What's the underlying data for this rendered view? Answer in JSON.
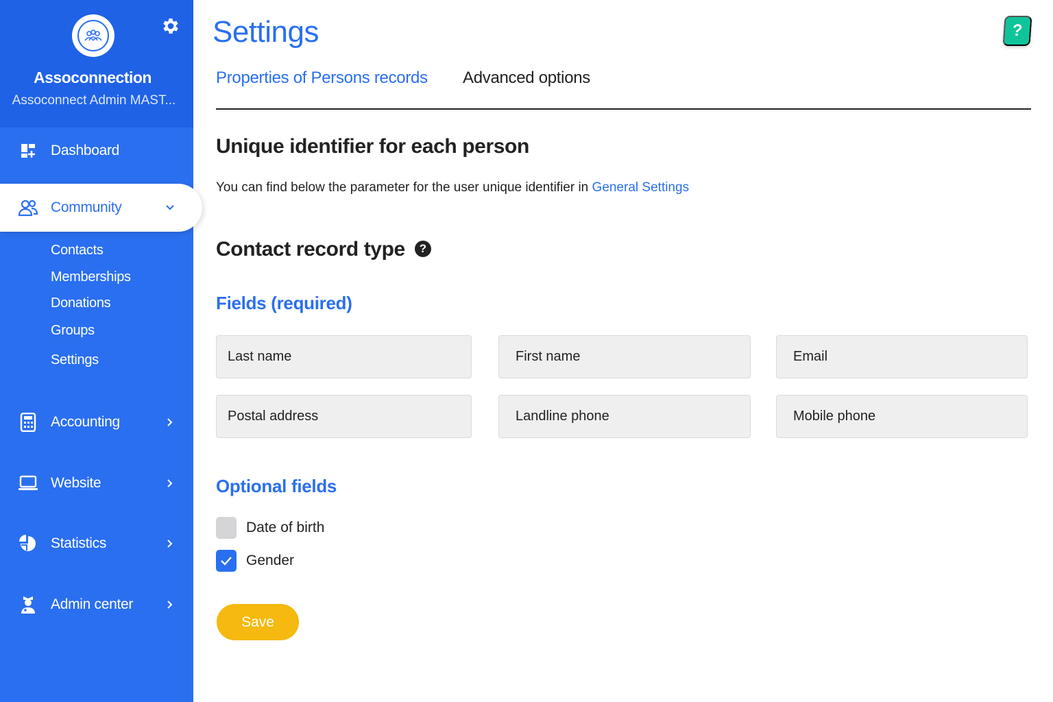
{
  "sidebar": {
    "org_name": "Assoconnection",
    "org_subtitle": "Assoconnect Admin MAST...",
    "nav": {
      "dashboard": {
        "label": "Dashboard",
        "icon": "dashboard-icon"
      },
      "community": {
        "label": "Community",
        "icon": "community-icon",
        "expanded": true
      },
      "accounting": {
        "label": "Accounting",
        "icon": "calculator-icon"
      },
      "website": {
        "label": "Website",
        "icon": "laptop-icon"
      },
      "statistics": {
        "label": "Statistics",
        "icon": "pie-chart-icon"
      },
      "admin_center": {
        "label": "Admin center",
        "icon": "admin-icon"
      }
    },
    "community_items": [
      "Contacts",
      "Memberships",
      "Donations",
      "Groups",
      "Settings"
    ]
  },
  "header": {
    "title": "Settings",
    "help": "?"
  },
  "tabs": {
    "properties": "Properties of Persons records",
    "advanced": "Advanced options",
    "active": "properties"
  },
  "unique_id": {
    "heading": "Unique identifier for each person",
    "note": "You can find below the parameter for the user unique identifier in ",
    "link": "General Settings"
  },
  "contact_type": {
    "heading": "Contact record type",
    "required_heading": "Fields (required)",
    "required_fields": [
      "Last name",
      "First name",
      "Email",
      "Postal address",
      "Landline phone",
      "Mobile phone"
    ],
    "optional_heading": "Optional fields",
    "optional_fields": [
      {
        "label": "Date of birth",
        "checked": false
      },
      {
        "label": "Gender",
        "checked": true
      }
    ]
  },
  "actions": {
    "save": "Save"
  },
  "colors": {
    "primary": "#2a6ff0",
    "sidebar_header": "#1f62e6",
    "help": "#10c49a",
    "save": "#f5b90f"
  }
}
